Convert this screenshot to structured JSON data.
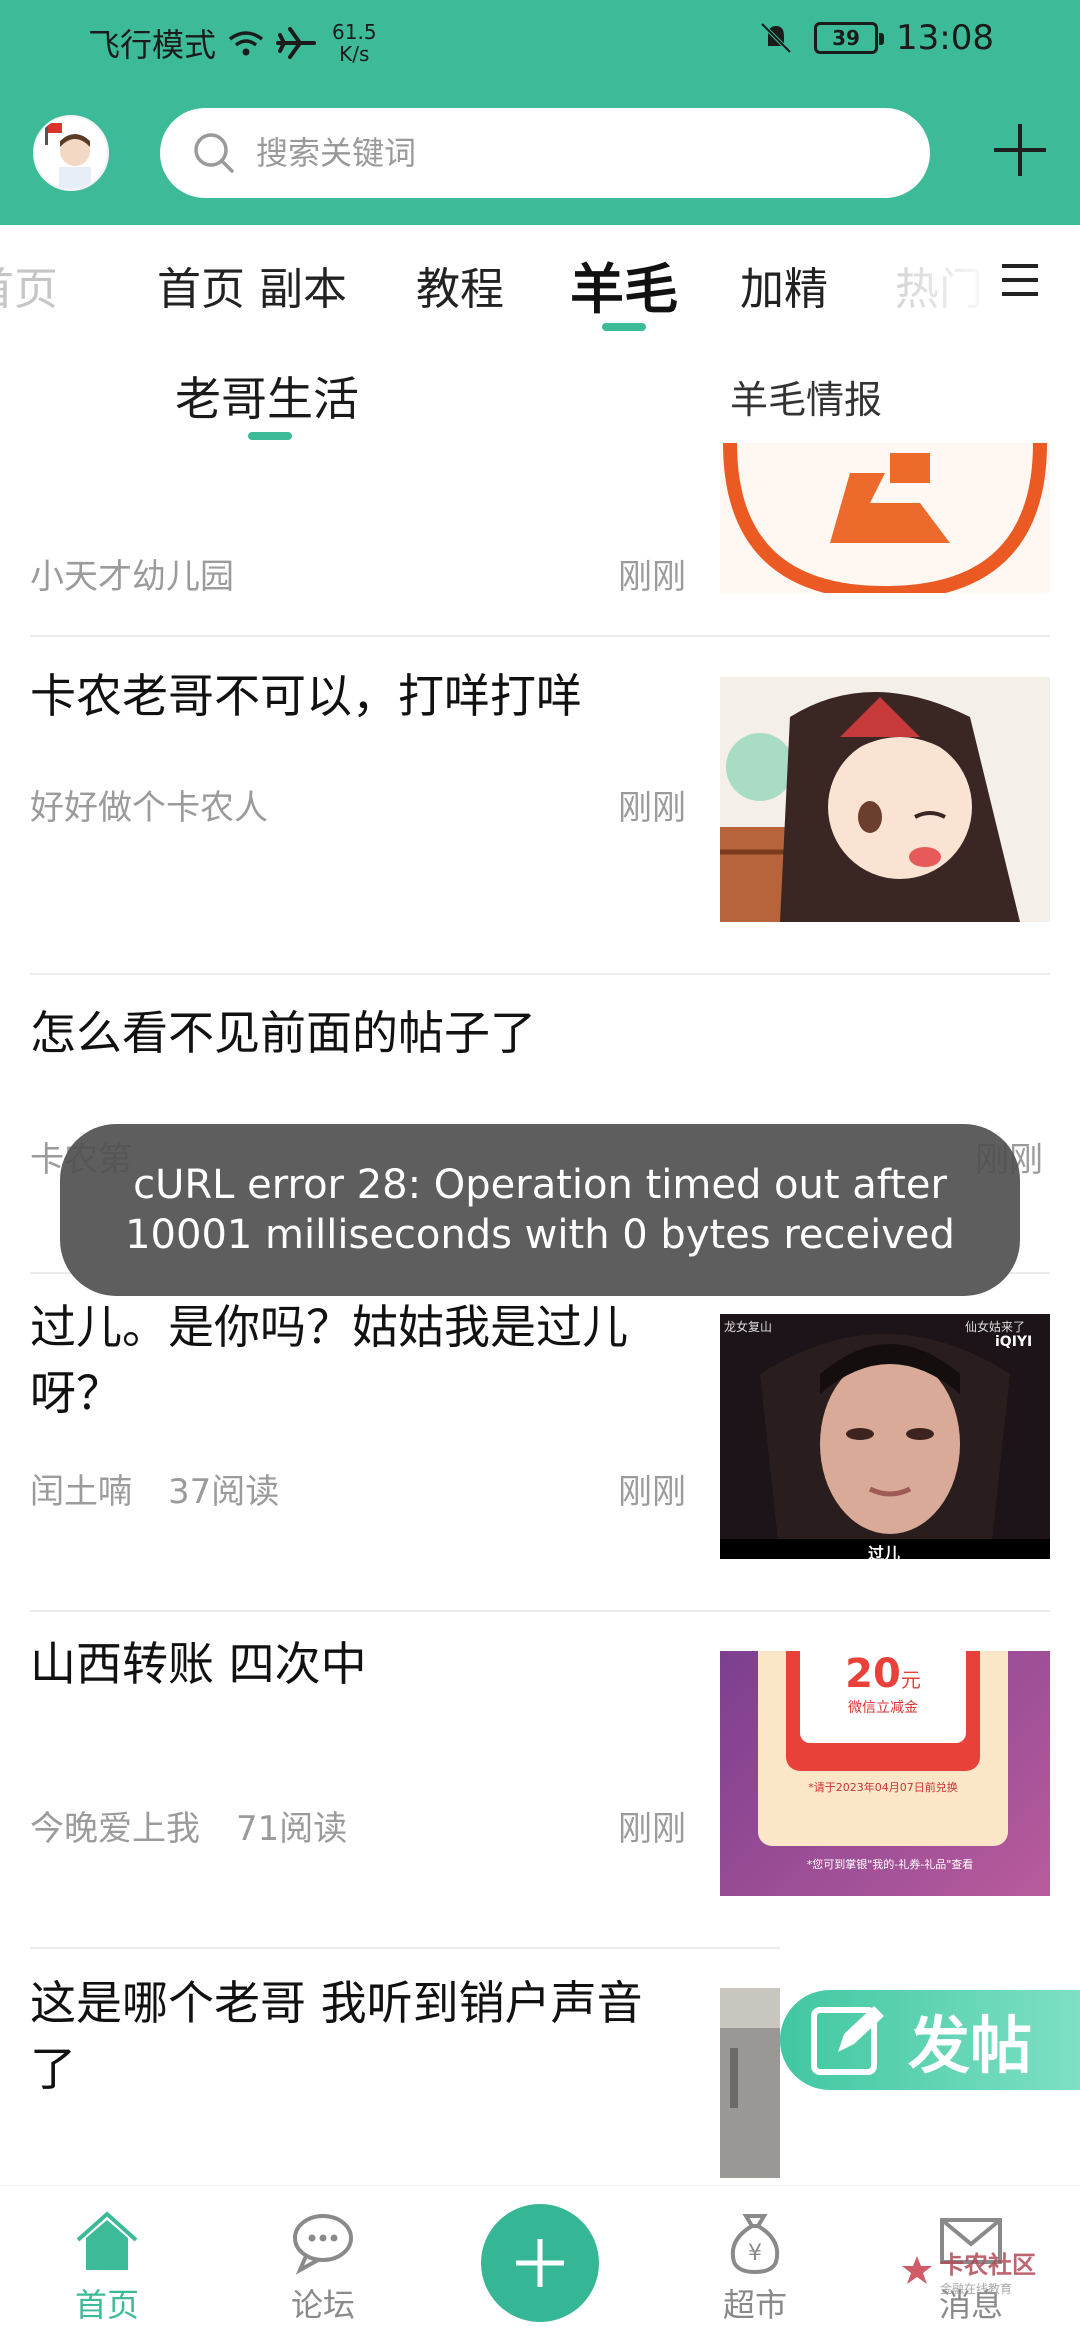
{
  "status_bar": {
    "mode": "飞行模式",
    "speed_value": "61.5",
    "speed_unit": "K/s",
    "battery": "39",
    "time": "13:08",
    "icons": [
      "wifi-icon",
      "airplane-icon",
      "bell-muted-icon",
      "battery-icon"
    ]
  },
  "search": {
    "placeholder": "搜索关键词"
  },
  "tabs": [
    {
      "label": "首页",
      "state": "faded"
    },
    {
      "label": "首页 副本",
      "state": "normal"
    },
    {
      "label": "教程",
      "state": "normal"
    },
    {
      "label": "羊毛",
      "state": "active"
    },
    {
      "label": "加精",
      "state": "normal"
    },
    {
      "label": "热门",
      "state": "faded"
    }
  ],
  "subtabs": {
    "active": "老哥生活",
    "other": "羊毛情报"
  },
  "posts": [
    {
      "title": "",
      "author": "小天才幼儿园",
      "reads": "",
      "time": "刚刚",
      "thumb": "orange-logo"
    },
    {
      "title": "卡农老哥不可以，打咩打咩",
      "author": "好好做个卡农人",
      "reads": "",
      "time": "刚刚",
      "thumb": "anime-girl"
    },
    {
      "title": "怎么看不见前面的帖子了",
      "author": "卡农第",
      "reads": "",
      "time": "刚刚",
      "thumb": ""
    },
    {
      "title": "过儿。是你吗？姑姑我是过儿呀？",
      "author": "闰土喃",
      "reads": "37阅读",
      "time": "刚刚",
      "thumb": "drama-still"
    },
    {
      "title": "山西转账 四次中",
      "author": "今晚爱上我",
      "reads": "71阅读",
      "time": "刚刚",
      "thumb": "coupon"
    },
    {
      "title": "这是哪个老哥 我听到销户声音了",
      "author": "",
      "reads": "",
      "time": "",
      "thumb": "street-photo"
    }
  ],
  "thumb_texts": {
    "drama_caption": "过儿",
    "drama_overlay_left": "龙女复山",
    "drama_overlay_right": "仙女姑来了",
    "drama_brand": "iQIYI",
    "coupon_amount": "20",
    "coupon_unit": "元",
    "coupon_sub": "微信立减金",
    "coupon_date": "*请于2023年04月07日前兑换",
    "coupon_note": "*您可到掌银\"我的-礼券-礼品\"查看"
  },
  "toast": {
    "message": "cURL error 28: Operation timed out after 10001 milliseconds with 0 bytes received"
  },
  "fab": {
    "label": "发帖"
  },
  "bottom_nav": [
    {
      "label": "首页",
      "icon": "home-icon",
      "active": true
    },
    {
      "label": "论坛",
      "icon": "chat-icon",
      "active": false
    },
    {
      "label": "",
      "icon": "plus-icon",
      "active": false
    },
    {
      "label": "超市",
      "icon": "money-bag-icon",
      "active": false
    },
    {
      "label": "消息",
      "icon": "mail-icon",
      "active": false
    }
  ],
  "watermark": {
    "name": "卡农社区",
    "slogan": "金融在线教育"
  },
  "colors": {
    "accent": "#3dbb98",
    "toast_bg": "#505050",
    "meta_text": "#9b9b9b"
  }
}
